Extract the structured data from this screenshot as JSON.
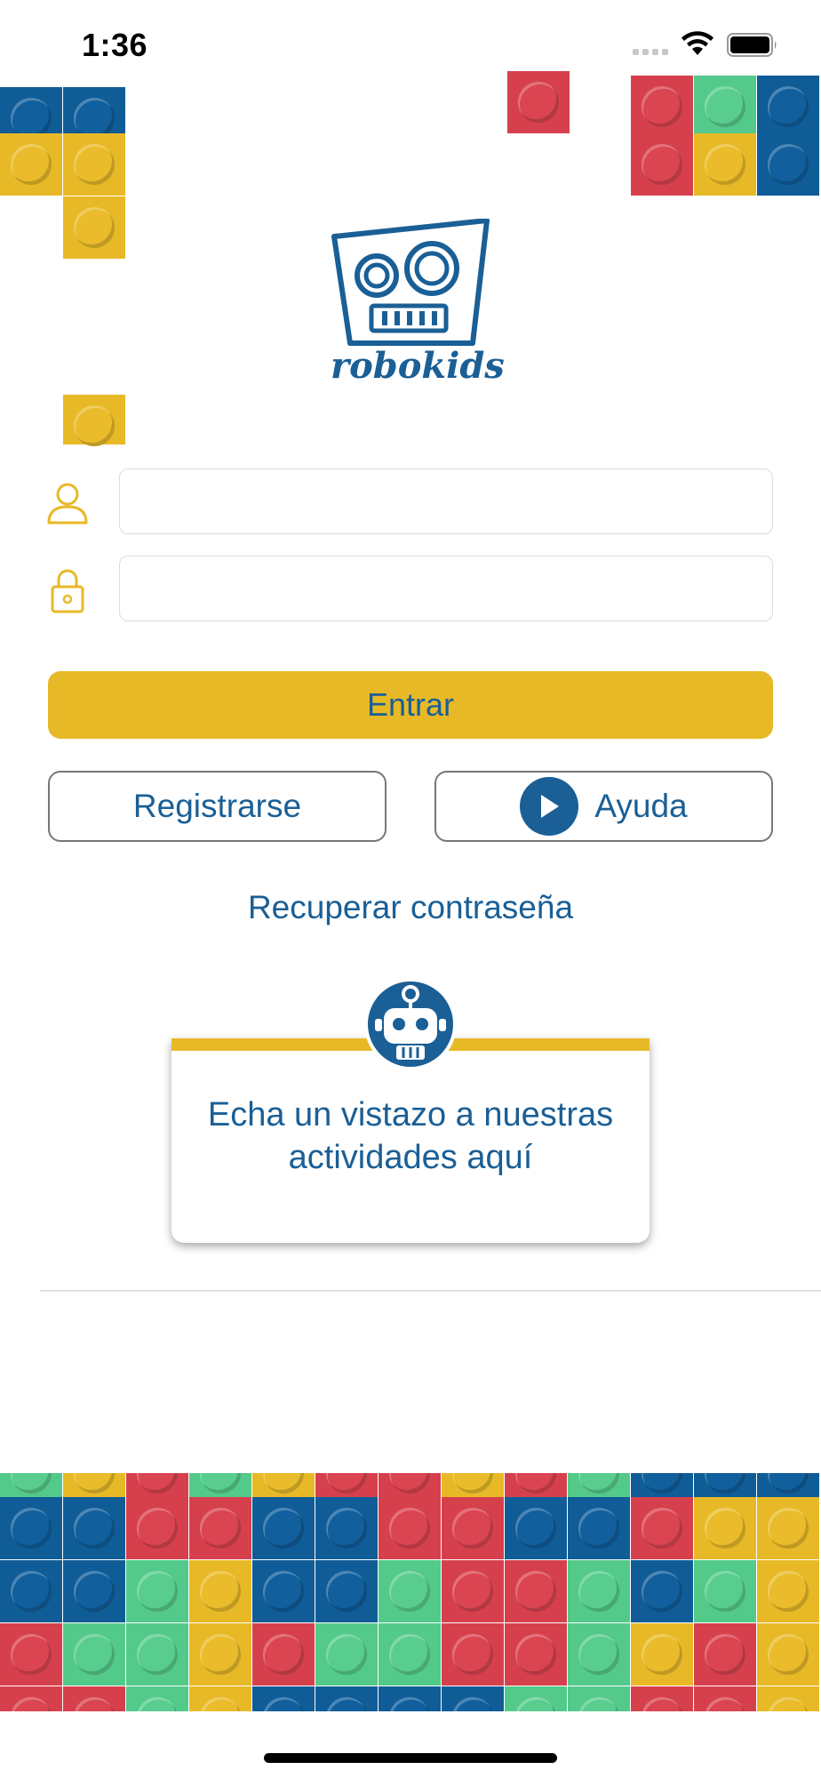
{
  "status_bar": {
    "time": "1:36"
  },
  "app": {
    "logo_text": "robokids"
  },
  "login": {
    "username_placeholder": "",
    "password_placeholder": "",
    "enter_label": "Entrar",
    "register_label": "Registrarse",
    "help_label": "Ayuda",
    "recover_label": "Recuperar contraseña"
  },
  "promo_card": {
    "text": "Echa un vistazo a nuestras actividades aquí"
  },
  "colors": {
    "brand_blue": "#1a5f96",
    "brand_yellow": "#e8b927",
    "brick_red": "#d6404d",
    "brick_green": "#53c98a"
  },
  "icons": [
    "user-icon",
    "lock-icon",
    "play-icon",
    "robot-icon",
    "wifi-icon",
    "battery-icon"
  ]
}
